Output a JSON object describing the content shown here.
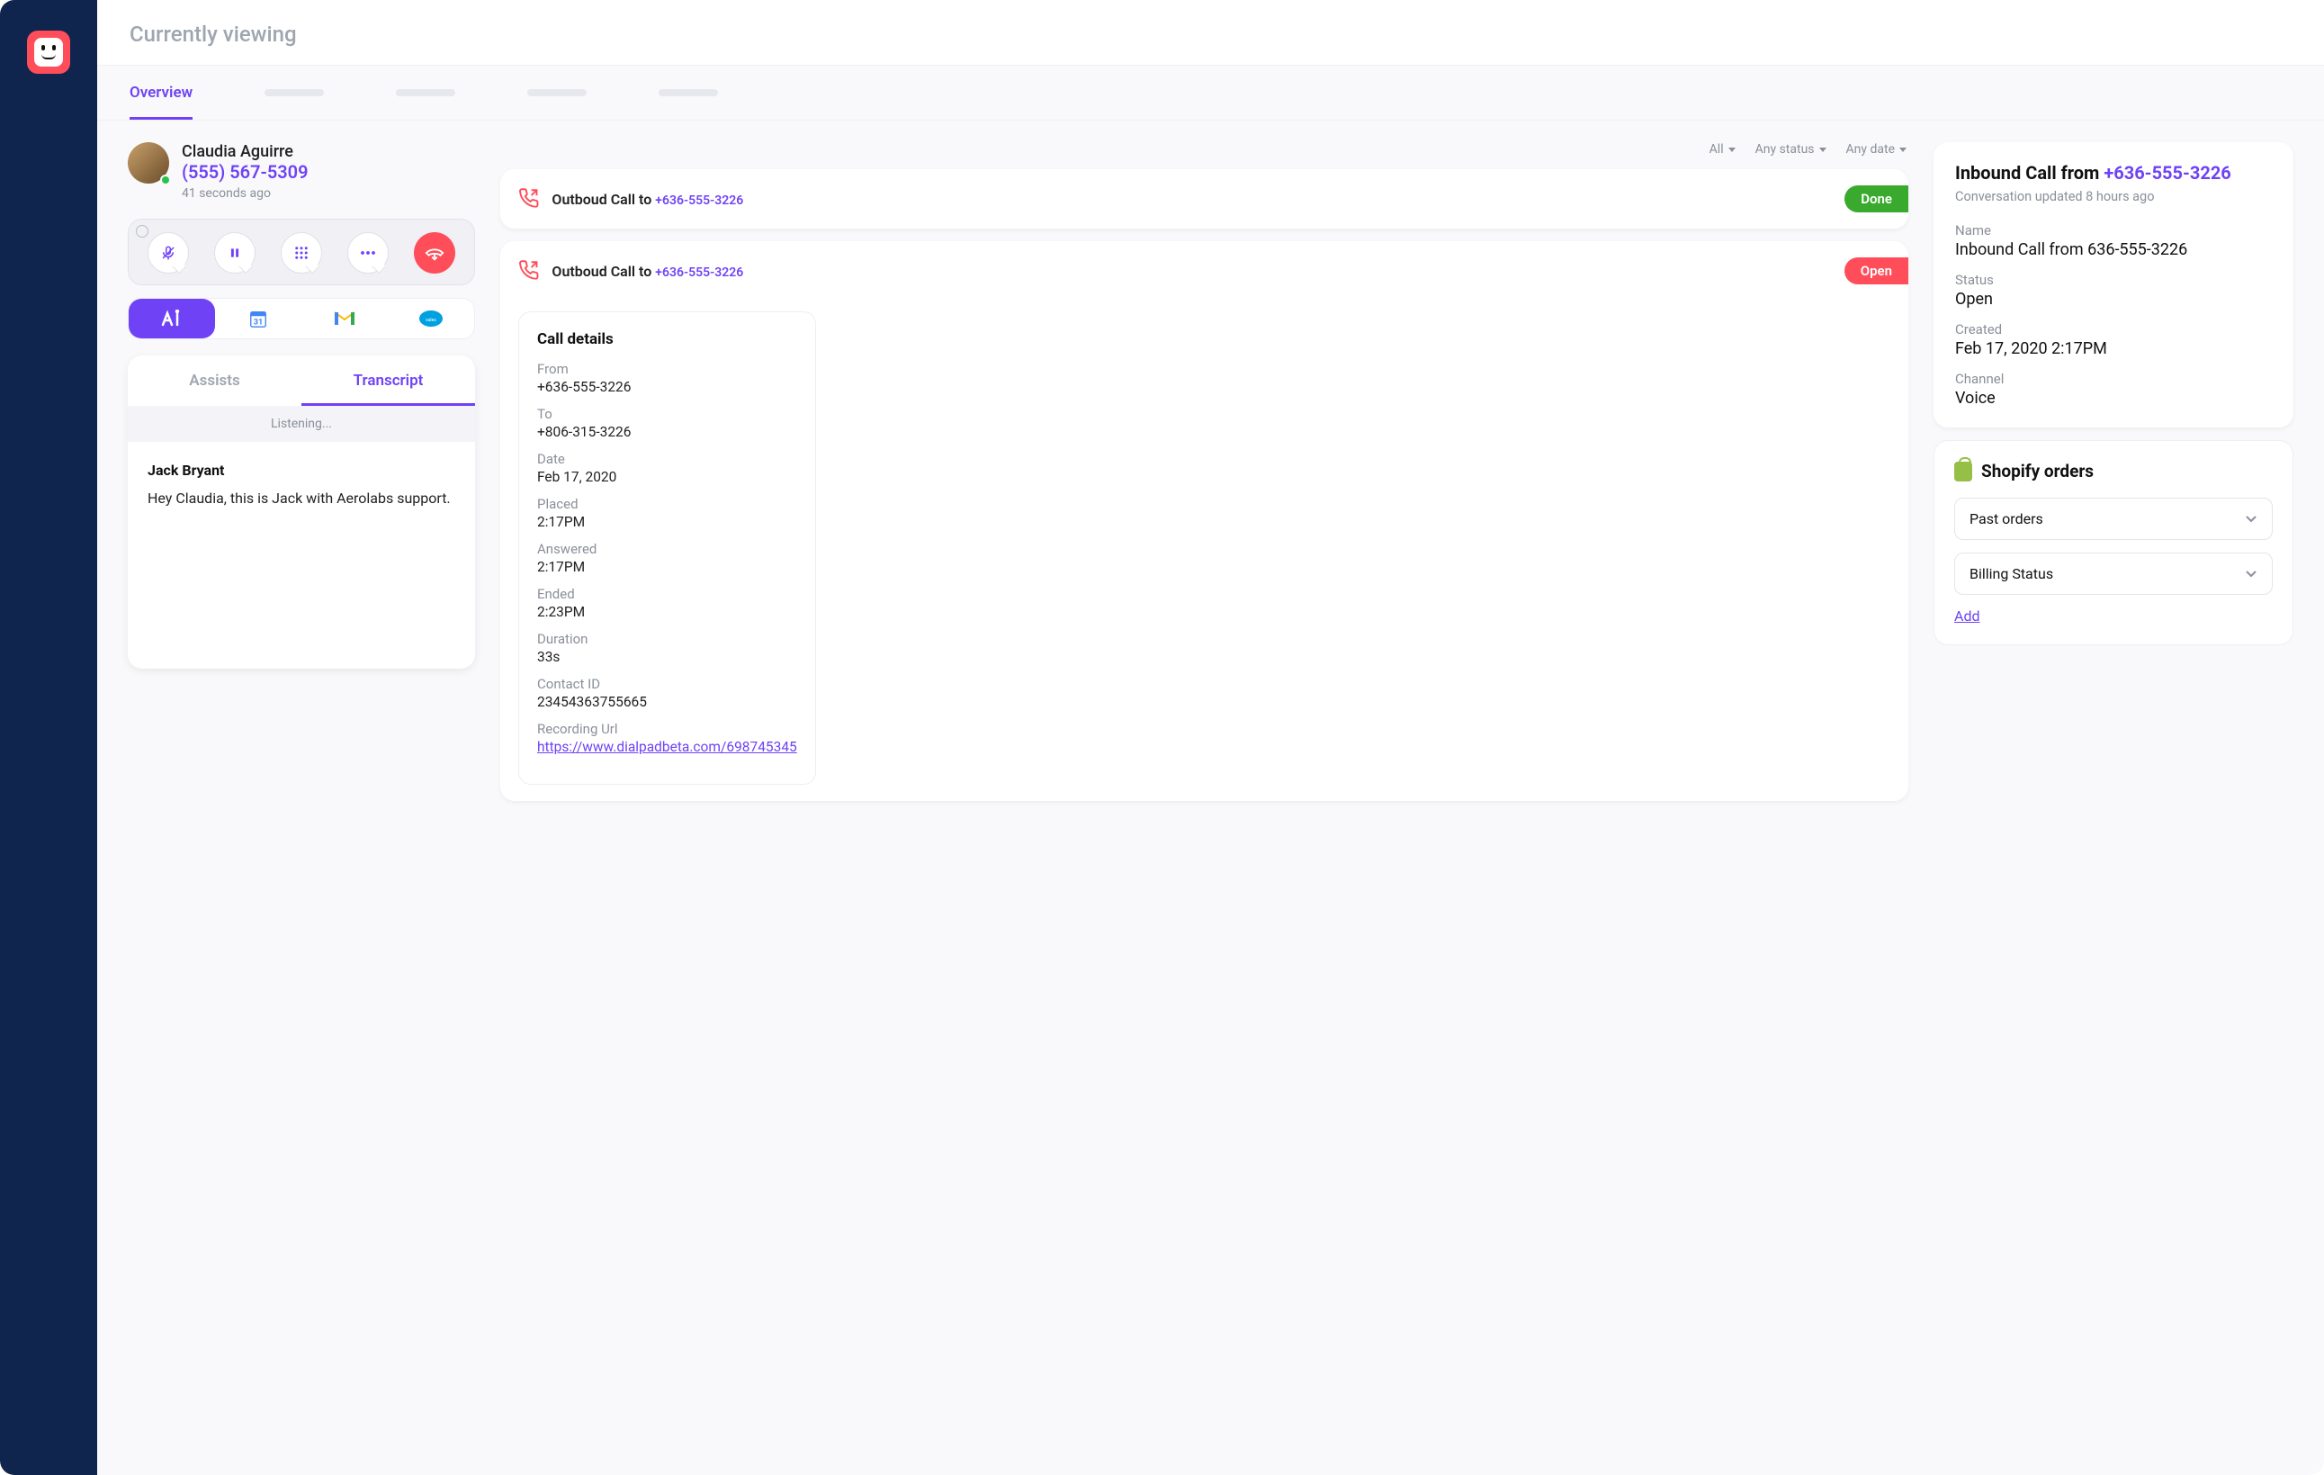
{
  "header": {
    "title": "Currently viewing"
  },
  "tabs": {
    "overview": "Overview"
  },
  "contact": {
    "name": "Claudia Aguirre",
    "phone": "(555) 567-5309",
    "time": "41 seconds ago"
  },
  "transcript_tabs": {
    "assists": "Assists",
    "transcript": "Transcript"
  },
  "transcript": {
    "listening": "Listening...",
    "speaker": "Jack Bryant",
    "text": "Hey Claudia, this is Jack with Aerolabs support."
  },
  "filters": {
    "all": "All",
    "status": "Any status",
    "date": "Any date"
  },
  "calls": [
    {
      "label_prefix": "Outboud Call to ",
      "number": "+636-555-3226",
      "status": "Done"
    },
    {
      "label_prefix": "Outboud Call to ",
      "number": "+636-555-3226",
      "status": "Open"
    }
  ],
  "call_details": {
    "title": "Call details",
    "from_label": "From",
    "from": "+636-555-3226",
    "to_label": "To",
    "to": "+806-315-3226",
    "date_label": "Date",
    "date": "Feb 17, 2020",
    "placed_label": "Placed",
    "placed": "2:17PM",
    "answered_label": "Answered",
    "answered": "2:17PM",
    "ended_label": "Ended",
    "ended": "2:23PM",
    "duration_label": "Duration",
    "duration": "33s",
    "contact_id_label": "Contact ID",
    "contact_id": "23454363755665",
    "recording_label": "Recording Url",
    "recording_url": "https://www.dialpadbeta.com/698745345"
  },
  "inbound": {
    "title_prefix": "Inbound Call from ",
    "title_number": "+636-555-3226",
    "updated": "Conversation updated 8 hours ago",
    "name_label": "Name",
    "name": "Inbound Call from 636-555-3226",
    "status_label": "Status",
    "status": "Open",
    "created_label": "Created",
    "created": "Feb 17, 2020 2:17PM",
    "channel_label": "Channel",
    "channel": "Voice"
  },
  "shopify": {
    "title": "Shopify orders",
    "past": "Past orders",
    "billing": "Billing Status",
    "add": "Add"
  }
}
